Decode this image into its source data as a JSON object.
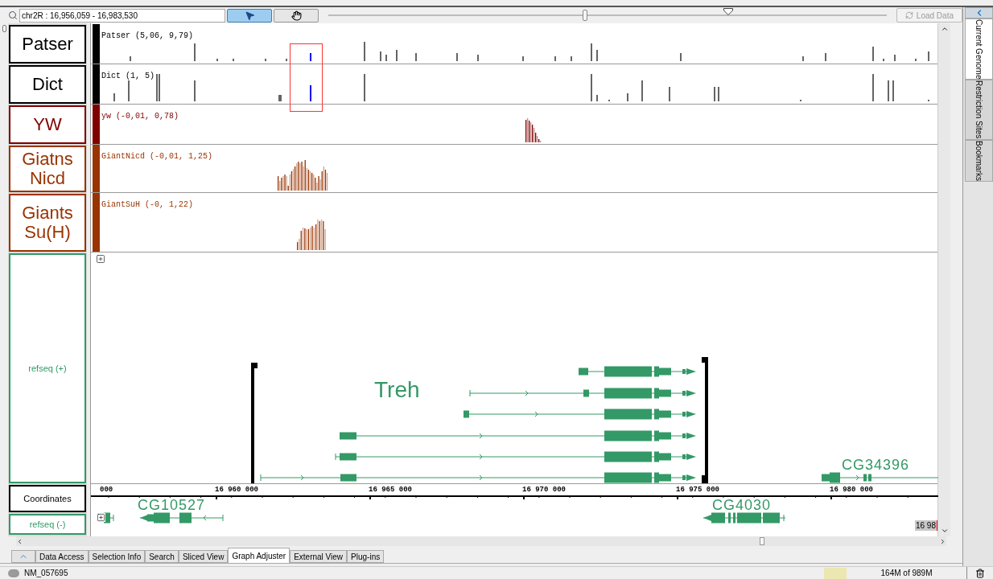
{
  "toolbar": {
    "search_field": "chr2R : 16,956,059 - 16,983,530",
    "modes": [
      {
        "kind": "select",
        "selected": true
      },
      {
        "kind": "pan",
        "selected": false
      }
    ],
    "zoom_slider": {
      "level": 0.46
    },
    "load_button": {
      "label": "Load Data",
      "disabled": true
    }
  },
  "tracks": [
    {
      "label": "Patser",
      "header": "Patser (5,06, 9,79)",
      "color": "#000000",
      "kind": "ticks"
    },
    {
      "label": "Dict",
      "header": "Dict (1, 5)",
      "color": "#000000",
      "kind": "ticks"
    },
    {
      "label": "YW",
      "header": "yw (-0,01, 0,78)",
      "color": "#800000",
      "kind": "graph"
    },
    {
      "label": "Giatns Nicd",
      "header": "GiantNicd (-0,01, 1,25)",
      "color": "#993300",
      "kind": "graph"
    },
    {
      "label": "Giants Su(H)",
      "header": "GiantSuH (-0, 1,22)",
      "color": "#993300",
      "kind": "graph"
    }
  ],
  "refseq_plus": {
    "label": "refseq (+)",
    "genes": [
      "Treh",
      "CG34396"
    ]
  },
  "coordinates": {
    "label": "Coordinates",
    "ticks": [
      "000",
      "16 960 000",
      "16 965 000",
      "16 970 000",
      "16 975 000",
      "16 980 000"
    ]
  },
  "refseq_minus": {
    "label": "refseq (-)",
    "genes": [
      "CG10527",
      "CG4030"
    ],
    "edge_label": "16 98"
  },
  "side_tabs": [
    {
      "label": "Current Genome",
      "selected": true
    },
    {
      "label": "Restriction Sites",
      "selected": false
    },
    {
      "label": "Bookmarks",
      "selected": false
    }
  ],
  "bottom_tabs": [
    {
      "label": "Data Access",
      "selected": false
    },
    {
      "label": "Selection Info",
      "selected": false
    },
    {
      "label": "Search",
      "selected": false
    },
    {
      "label": "Sliced View",
      "selected": false
    },
    {
      "label": "Graph Adjuster",
      "selected": true
    },
    {
      "label": "External View",
      "selected": false
    },
    {
      "label": "Plug-ins",
      "selected": false
    }
  ],
  "status_bar": {
    "selection": "NM_057695",
    "memory": "164M of 989M"
  }
}
